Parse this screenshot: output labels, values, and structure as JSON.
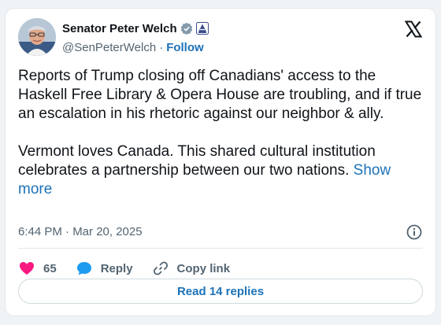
{
  "tweet": {
    "author": {
      "display_name": "Senator Peter Welch",
      "handle": "@SenPeterWelch",
      "follow_label": "Follow",
      "separator": "·",
      "verified_icon": "verified-badge-icon",
      "affiliate_icon": "government-affiliate-icon"
    },
    "body_paragraph_1": "Reports of Trump closing off Canadians' access to the Haskell Free Library & Opera House are troubling, and if true an escalation in his rhetoric against our neighbor & ally.",
    "body_paragraph_2": "Vermont loves Canada. This shared cultural institution celebrates a partnership between our two nations. ",
    "show_more_label": "Show more",
    "timestamp": "6:44 PM · Mar 20, 2025",
    "actions": {
      "like_count": "65",
      "reply_label": "Reply",
      "copy_link_label": "Copy link"
    },
    "read_replies_label": "Read 14 replies"
  },
  "colors": {
    "link": "#1d72b8",
    "heart": "#f91880",
    "text": "#0f1419",
    "secondary": "#536471"
  }
}
